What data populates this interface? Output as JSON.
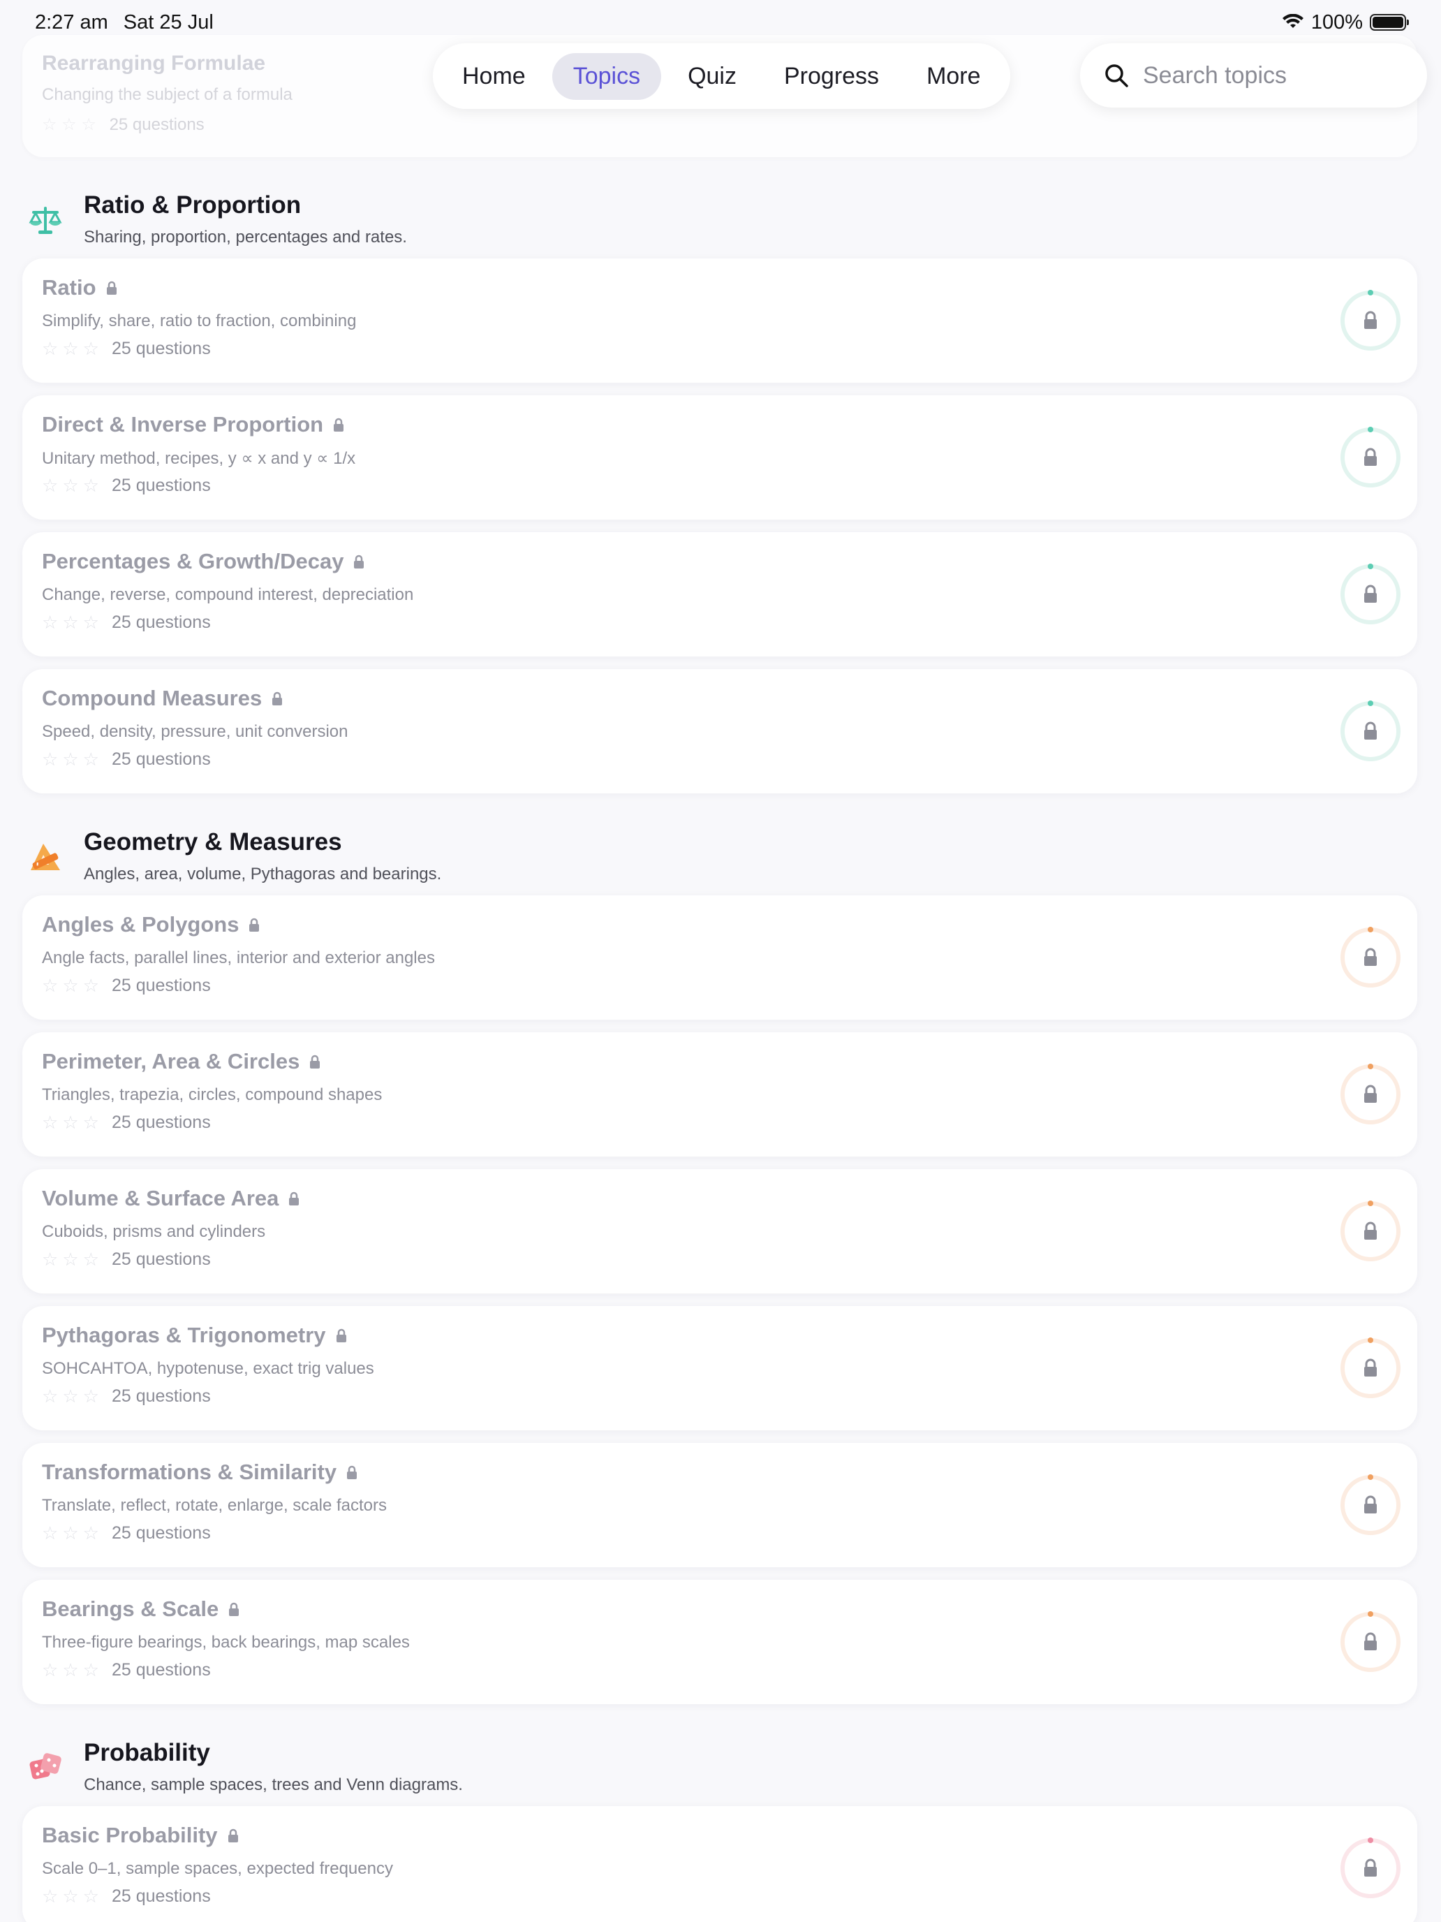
{
  "status_bar": {
    "time": "2:27 am",
    "date": "Sat 25 Jul",
    "battery": "100%"
  },
  "nav": {
    "items": [
      "Home",
      "Topics",
      "Quiz",
      "Progress",
      "More"
    ],
    "active": "Topics"
  },
  "search": {
    "placeholder": "Search topics"
  },
  "partial_card": {
    "title": "Rearranging Formulae",
    "desc": "Changing the subject of a formula",
    "questions": "25 questions"
  },
  "colors": {
    "accent": "#5b52d6",
    "ratio": "#5ccdb3",
    "geometry": "#f0a060",
    "probability": "#ee8ea4"
  },
  "sections": [
    {
      "title": "Ratio & Proportion",
      "subtitle": "Sharing, proportion, percentages and rates.",
      "icon": "scales-icon",
      "topics": [
        {
          "title": "Ratio",
          "desc": "Simplify, share, ratio to fraction, combining",
          "questions": "25 questions"
        },
        {
          "title": "Direct & Inverse Proportion",
          "desc": "Unitary method, recipes, y ∝ x and y ∝ 1/x",
          "questions": "25 questions"
        },
        {
          "title": "Percentages & Growth/Decay",
          "desc": "Change, reverse, compound interest, depreciation",
          "questions": "25 questions"
        },
        {
          "title": "Compound Measures",
          "desc": "Speed, density, pressure, unit conversion",
          "questions": "25 questions"
        }
      ]
    },
    {
      "title": "Geometry & Measures",
      "subtitle": "Angles, area, volume, Pythagoras and bearings.",
      "icon": "triangle-ruler-icon",
      "topics": [
        {
          "title": "Angles & Polygons",
          "desc": "Angle facts, parallel lines, interior and exterior angles",
          "questions": "25 questions"
        },
        {
          "title": "Perimeter, Area & Circles",
          "desc": "Triangles, trapezia, circles, compound shapes",
          "questions": "25 questions"
        },
        {
          "title": "Volume & Surface Area",
          "desc": "Cuboids, prisms and cylinders",
          "questions": "25 questions"
        },
        {
          "title": "Pythagoras & Trigonometry",
          "desc": "SOHCAHTOA, hypotenuse, exact trig values",
          "questions": "25 questions"
        },
        {
          "title": "Transformations & Similarity",
          "desc": "Translate, reflect, rotate, enlarge, scale factors",
          "questions": "25 questions"
        },
        {
          "title": "Bearings & Scale",
          "desc": "Three-figure bearings, back bearings, map scales",
          "questions": "25 questions"
        }
      ]
    },
    {
      "title": "Probability",
      "subtitle": "Chance, sample spaces, trees and Venn diagrams.",
      "icon": "dice-icon",
      "topics": [
        {
          "title": "Basic Probability",
          "desc": "Scale 0–1, sample spaces, expected frequency",
          "questions": "25 questions"
        }
      ]
    }
  ]
}
